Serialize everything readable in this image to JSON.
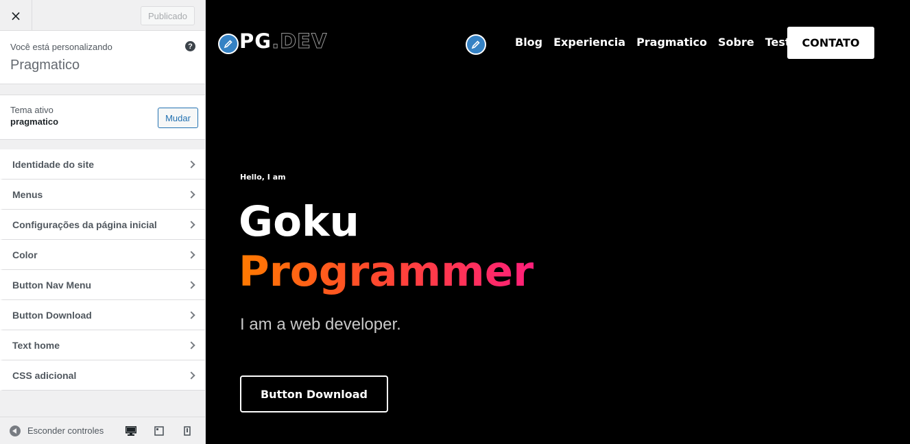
{
  "sidebar": {
    "close_label": "×",
    "publish_label": "Publicado",
    "customizing_label": "Você está personalizando",
    "site_title": "Pragmatico",
    "help_label": "?",
    "theme": {
      "label": "Tema ativo",
      "name": "pragmatico",
      "change_label": "Mudar"
    },
    "sections": [
      {
        "label": "Identidade do site"
      },
      {
        "label": "Menus"
      },
      {
        "label": "Configurações da página inicial"
      },
      {
        "label": "Color"
      },
      {
        "label": "Button Nav Menu"
      },
      {
        "label": "Button Download"
      },
      {
        "label": "Text home"
      },
      {
        "label": "CSS adicional"
      }
    ],
    "footer": {
      "hide_label": "Esconder controles"
    }
  },
  "preview": {
    "logo": {
      "part_a": "PG",
      "part_b": ".DEV"
    },
    "nav": [
      "Blog",
      "Experiencia",
      "Pragmatico",
      "Sobre",
      "Teste"
    ],
    "contact_label": "CONTATO",
    "hero": {
      "hello": "Hello, I am",
      "name": "Goku",
      "role": "Programmer",
      "description": "I am a web developer.",
      "button_label": "Button Download"
    }
  },
  "colors": {
    "accent": "#2271b1",
    "edit_icon": "#3582c4",
    "gradient_start": "#ff7a00",
    "gradient_end": "#ff1f7a"
  }
}
